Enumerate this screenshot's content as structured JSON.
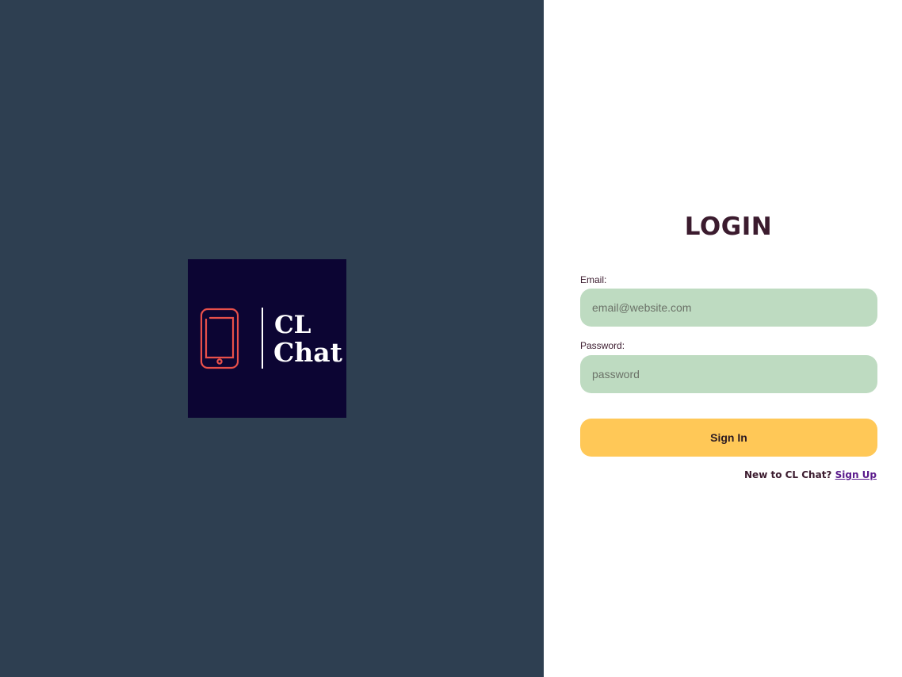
{
  "logo": {
    "line1": "CL",
    "line2": "Chat",
    "icon": "phone-icon",
    "background_color": "#0c0533",
    "icon_color": "#e8504a"
  },
  "login": {
    "title": "LOGIN",
    "email_label": "Email:",
    "email_placeholder": "email@website.com",
    "email_value": "",
    "password_label": "Password:",
    "password_placeholder": "password",
    "password_value": "",
    "signin_label": "Sign In",
    "signup_prompt": "New to CL Chat?",
    "signup_link": "Sign Up"
  },
  "colors": {
    "left_pane": "#2e3f51",
    "input_background": "#bedbc1",
    "button_background": "#ffc857",
    "title_color": "#3b1b2e",
    "link_color": "#5a1a8c"
  }
}
